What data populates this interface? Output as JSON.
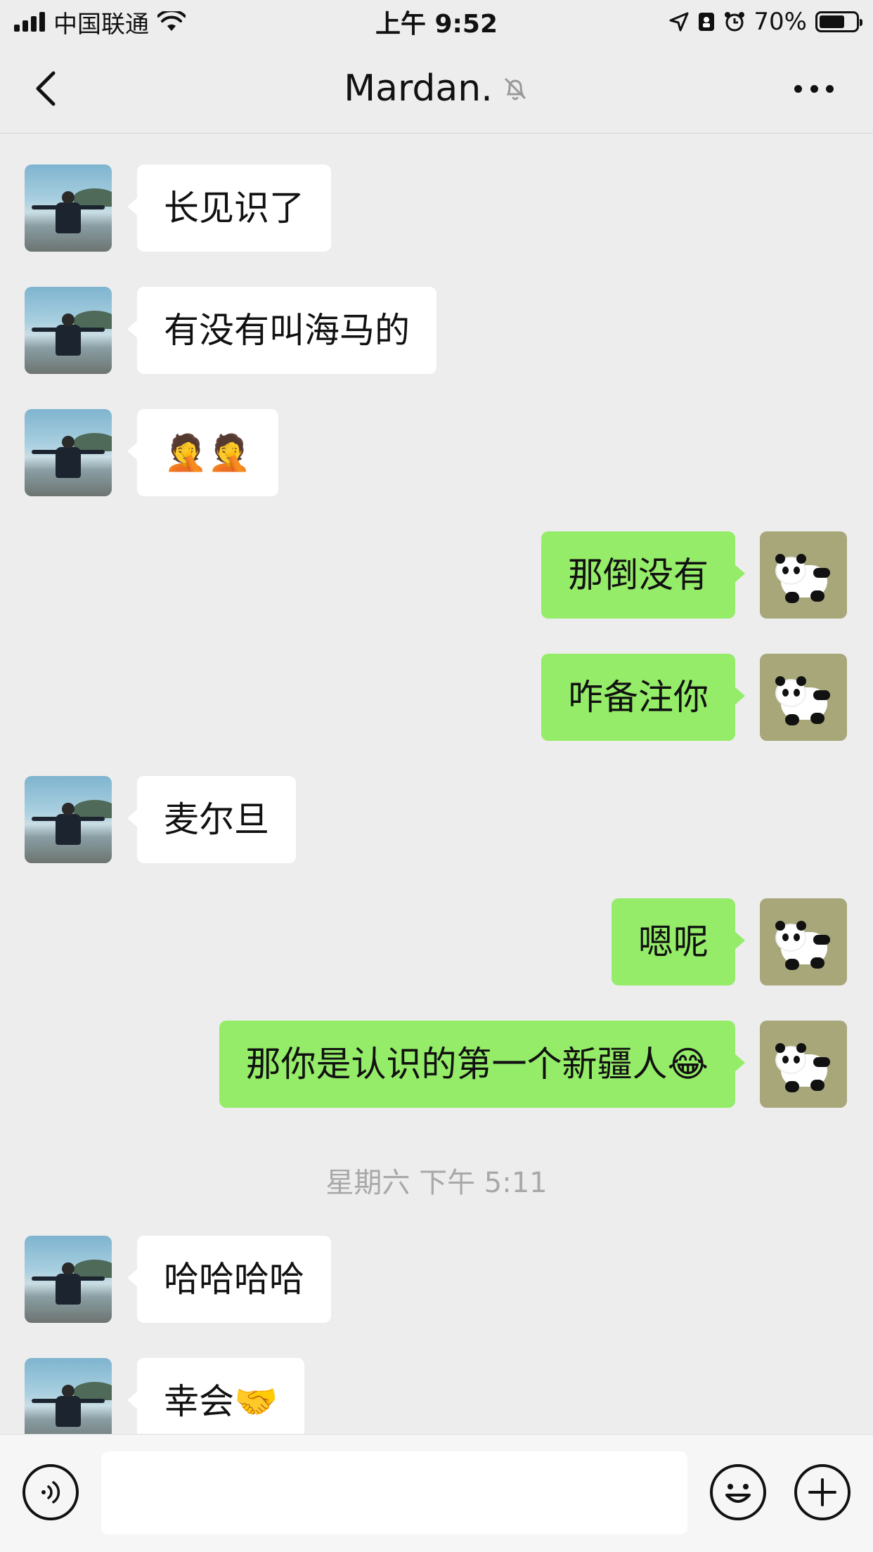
{
  "status_bar": {
    "carrier": "中国联通",
    "time": "上午 9:52",
    "battery_percent": "70%",
    "battery_level": 0.7
  },
  "nav": {
    "title": "Mardan.",
    "back_icon": "chevron-left-icon",
    "mute_icon": "bell-slash-icon",
    "more_icon": "more-dots-icon"
  },
  "messages": [
    {
      "side": "left",
      "text": "长见识了"
    },
    {
      "side": "left",
      "text": "有没有叫海马的"
    },
    {
      "side": "left",
      "text": "🤦🤦"
    },
    {
      "side": "right",
      "text": "那倒没有"
    },
    {
      "side": "right",
      "text": "咋备注你"
    },
    {
      "side": "left",
      "text": "麦尔旦"
    },
    {
      "side": "right",
      "text": "嗯呢"
    },
    {
      "side": "right",
      "text": "那你是认识的第一个新疆人😂"
    },
    {
      "side": "left",
      "text": "哈哈哈哈"
    },
    {
      "side": "left",
      "text": "幸会🤝"
    }
  ],
  "time_divider": "星期六 下午 5:11",
  "input_bar": {
    "voice_icon": "voice-icon",
    "input_value": "",
    "emoji_icon": "emoji-icon",
    "plus_icon": "plus-icon"
  },
  "colors": {
    "background": "#ededed",
    "sent_bubble": "#95ec69",
    "received_bubble": "#ffffff"
  }
}
